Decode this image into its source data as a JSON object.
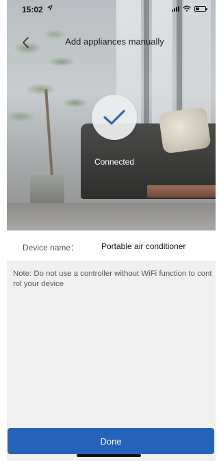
{
  "status_bar": {
    "time": "15:02",
    "location_icon": "location-arrow-icon",
    "signal_icon": "cellular-signal-icon",
    "wifi_icon": "wifi-icon",
    "battery_icon": "battery-icon",
    "battery_level": 0.4
  },
  "header": {
    "back_icon": "chevron-left-icon",
    "title": "Add appliances manually"
  },
  "status": {
    "icon": "checkmark-icon",
    "label": "Connected",
    "accent_color": "#2c66b5"
  },
  "device": {
    "label": "Device name：",
    "value": "Portable air conditioner"
  },
  "note": {
    "text": "Note: Do not use a controller without WiFi function to control your device"
  },
  "footer": {
    "done_label": "Done",
    "button_color": "#2563b8"
  }
}
